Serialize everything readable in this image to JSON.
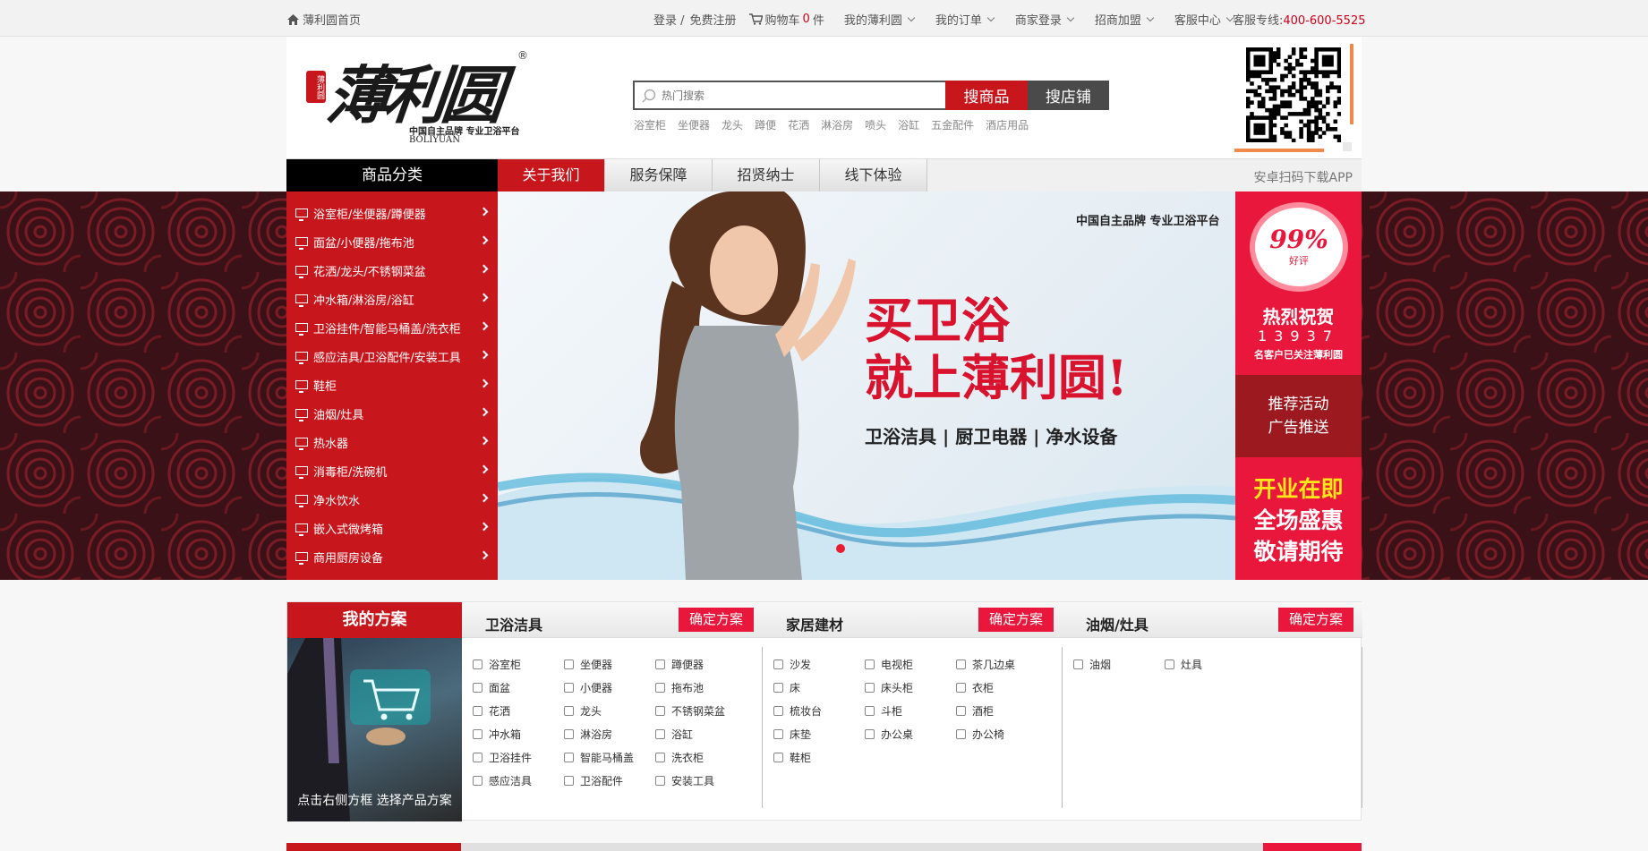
{
  "topbar": {
    "home": "薄利圆首页",
    "login": "登录 /",
    "register": "免费注册",
    "cart_label": "购物车",
    "cart_count": "0",
    "cart_unit": "件",
    "my_site": "我的薄利圆",
    "my_orders": "我的订单",
    "merchant_login": "商家登录",
    "join": "招商加盟",
    "service": "客服中心",
    "hotline_label": "客服专线:",
    "hotline_number": "400-600-5525"
  },
  "header": {
    "logo_brand": "薄利圆",
    "logo_seal": "薄利圆",
    "logo_reg": "®",
    "logo_slogan": "中国自主品牌 专业卫浴平台",
    "logo_en": "BOLIYUAN",
    "search_placeholder": "热门搜索",
    "search_goods": "搜商品",
    "search_shop": "搜店铺",
    "hotwords": [
      "浴室柜",
      "坐便器",
      "龙头",
      "蹲便",
      "花洒",
      "淋浴房",
      "喷头",
      "浴缸",
      "五金配件",
      "酒店用品"
    ]
  },
  "nav": {
    "category": "商品分类",
    "tabs": [
      "关于我们",
      "服务保障",
      "招贤纳士",
      "线下体验"
    ],
    "app": "安卓扫码下载APP"
  },
  "menu": [
    "浴室柜/坐便器/蹲便器",
    "面盆/小便器/拖布池",
    "花洒/龙头/不锈钢菜盆",
    "冲水箱/淋浴房/浴缸",
    "卫浴挂件/智能马桶盖/洗衣柜",
    "感应洁具/卫浴配件/安装工具",
    "鞋柜",
    "油烟/灶具",
    "热水器",
    "消毒柜/洗碗机",
    "净水饮水",
    "嵌入式微烤箱",
    "商用厨房设备"
  ],
  "hero": {
    "tagline": "中国自主品牌  专业卫浴平台",
    "line1": "买卫浴",
    "line2": "就上薄利圆!",
    "sub": "卫浴洁具 | 厨卫电器 | 净水设备"
  },
  "side": {
    "pct": "99%",
    "good": "好评",
    "congrats": "热烈祝贺",
    "count": "13937",
    "customers": "名客户已关注薄利圆",
    "promo_l1": "推荐活动",
    "promo_l2": "广告推送",
    "open1": "开业在即",
    "open2": "全场盛惠",
    "open3": "敬请期待"
  },
  "plan": {
    "title": "我的方案",
    "caption": "点击右侧方框  选择产品方案",
    "confirm": "确定方案",
    "groups": [
      {
        "title": "卫浴洁具",
        "rows": [
          [
            "浴室柜",
            "坐便器",
            "蹲便器"
          ],
          [
            "面盆",
            "小便器",
            "拖布池"
          ],
          [
            "花洒",
            "龙头",
            "不锈钢菜盆"
          ],
          [
            "冲水箱",
            "淋浴房",
            "浴缸"
          ],
          [
            "卫浴挂件",
            "智能马桶盖",
            "洗衣柜"
          ],
          [
            "感应洁具",
            "卫浴配件",
            "安装工具"
          ]
        ]
      },
      {
        "title": "家居建材",
        "rows": [
          [
            "沙发",
            "电视柜",
            "茶几边桌"
          ],
          [
            "床",
            "床头柜",
            "衣柜"
          ],
          [
            "梳妆台",
            "斗柜",
            "酒柜"
          ],
          [
            "床垫",
            "办公桌",
            "办公椅"
          ],
          [
            "鞋柜"
          ]
        ]
      },
      {
        "title": "油烟/灶具",
        "rows": [
          [
            "油烟",
            "灶具"
          ]
        ]
      }
    ]
  },
  "colors": {
    "brand_red": "#c8161d",
    "accent_red": "#e8173b",
    "open_yellow": "#ffe71a",
    "qr_accent": "#f08a4b"
  }
}
